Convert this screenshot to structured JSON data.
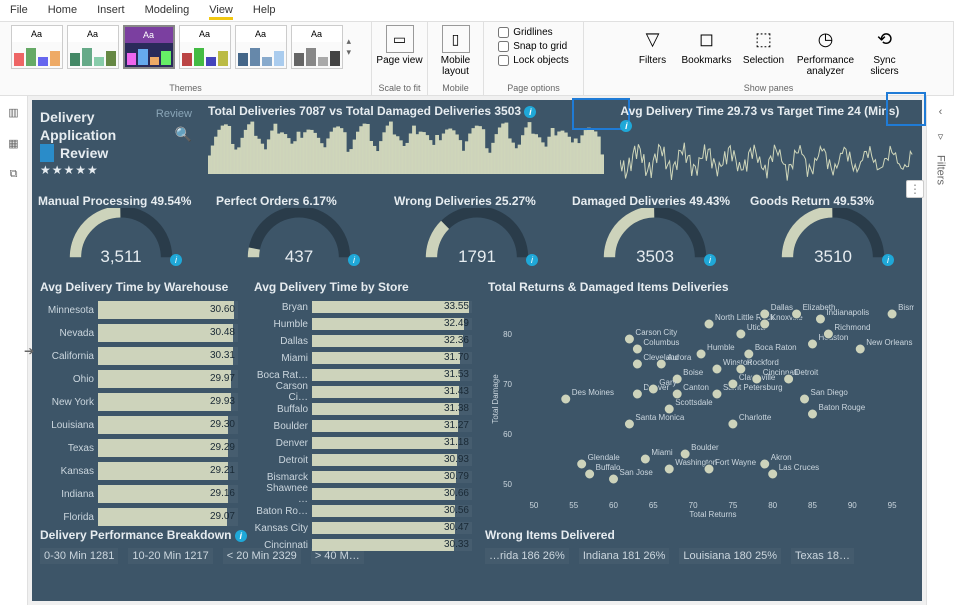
{
  "menu": {
    "file": "File",
    "home": "Home",
    "insert": "Insert",
    "modeling": "Modeling",
    "view": "View",
    "help": "Help"
  },
  "ribbon": {
    "themes_label": "Themes",
    "theme_sample": "Aa",
    "scale": {
      "page_view": "Page view",
      "label": "Scale to fit"
    },
    "mobile": {
      "layout": "Mobile layout",
      "label": "Mobile"
    },
    "page": {
      "gridlines": "Gridlines",
      "snap": "Snap to grid",
      "lock": "Lock objects",
      "label": "Page options"
    },
    "panes": {
      "filters": "Filters",
      "bookmarks": "Bookmarks",
      "selection": "Selection",
      "perf": "Performance analyzer",
      "sync": "Sync slicers",
      "label": "Show panes"
    }
  },
  "right_rail": {
    "filters": "Filters"
  },
  "title": {
    "l1": "Delivery",
    "l2": "Application",
    "l3": "Review",
    "review": "Review",
    "stars": "★★★★★"
  },
  "hdr1": {
    "text_prefix": "Total Deliveries ",
    "text_mid": " vs Total Damaged Deliveries ",
    "deliveries": "7087",
    "damaged": "3503"
  },
  "hdr2": {
    "text_prefix": "Avg Delivery Time ",
    "text_mid": " vs Target Time ",
    "text_suffix": " (Mins)",
    "avg": "29.73",
    "target": "24"
  },
  "gauges": [
    {
      "label": "Manual Processing 49.54%",
      "value": "3,511",
      "pct": 49.54
    },
    {
      "label": "Perfect Orders 6.17%",
      "value": "437",
      "pct": 6.17
    },
    {
      "label": "Wrong Deliveries 25.27%",
      "value": "1791",
      "pct": 25.27
    },
    {
      "label": "Damaged Deliveries 49.43%",
      "value": "3503",
      "pct": 49.43
    },
    {
      "label": "Goods Return 49.53%",
      "value": "3510",
      "pct": 49.53
    }
  ],
  "warehouse": {
    "title": "Avg Delivery Time by Warehouse",
    "rows": [
      {
        "label": "Minnesota",
        "value": 30.6
      },
      {
        "label": "Nevada",
        "value": 30.48
      },
      {
        "label": "California",
        "value": 30.31
      },
      {
        "label": "Ohio",
        "value": 29.97
      },
      {
        "label": "New York",
        "value": 29.93
      },
      {
        "label": "Louisiana",
        "value": 29.3
      },
      {
        "label": "Texas",
        "value": 29.29
      },
      {
        "label": "Kansas",
        "value": 29.21
      },
      {
        "label": "Indiana",
        "value": 29.16
      },
      {
        "label": "Florida",
        "value": 29.07
      }
    ]
  },
  "store": {
    "title": "Avg Delivery Time by Store",
    "rows": [
      {
        "label": "Bryan",
        "value": 33.55
      },
      {
        "label": "Humble",
        "value": 32.49
      },
      {
        "label": "Dallas",
        "value": 32.36
      },
      {
        "label": "Miami",
        "value": 31.7
      },
      {
        "label": "Boca Rat…",
        "value": 31.53
      },
      {
        "label": "Carson Ci…",
        "value": 31.43
      },
      {
        "label": "Buffalo",
        "value": 31.38
      },
      {
        "label": "Boulder",
        "value": 31.27
      },
      {
        "label": "Denver",
        "value": 31.18
      },
      {
        "label": "Detroit",
        "value": 30.93
      },
      {
        "label": "Bismarck",
        "value": 30.79
      },
      {
        "label": "Shawnee …",
        "value": 30.66
      },
      {
        "label": "Baton Ro…",
        "value": 30.56
      },
      {
        "label": "Kansas City",
        "value": 30.47
      },
      {
        "label": "Cincinnati",
        "value": 30.33
      }
    ]
  },
  "scatter": {
    "title": "Total Returns & Damaged Items Deliveries",
    "xlabel": "Total Returns",
    "ylabel": "Total Damage",
    "xticks": [
      50,
      55,
      60,
      65,
      70,
      75,
      80,
      85,
      90,
      95
    ],
    "yticks": [
      50,
      60,
      70,
      80
    ],
    "points": [
      {
        "label": "Des Moines",
        "x": 54,
        "y": 67
      },
      {
        "label": "Santa Monica",
        "x": 62,
        "y": 62
      },
      {
        "label": "Denver",
        "x": 63,
        "y": 68
      },
      {
        "label": "Glendale",
        "x": 56,
        "y": 54
      },
      {
        "label": "Buffalo",
        "x": 57,
        "y": 52
      },
      {
        "label": "San Jose",
        "x": 60,
        "y": 51
      },
      {
        "label": "Miami",
        "x": 64,
        "y": 55
      },
      {
        "label": "Washington",
        "x": 67,
        "y": 53
      },
      {
        "label": "Boulder",
        "x": 69,
        "y": 56
      },
      {
        "label": "Fort Wayne",
        "x": 72,
        "y": 53
      },
      {
        "label": "Scottsdale",
        "x": 67,
        "y": 65
      },
      {
        "label": "Canton",
        "x": 68,
        "y": 68
      },
      {
        "label": "Boise",
        "x": 68,
        "y": 71
      },
      {
        "label": "Cleveland",
        "x": 63,
        "y": 74
      },
      {
        "label": "Aurora",
        "x": 66,
        "y": 74
      },
      {
        "label": "Columbus",
        "x": 63,
        "y": 77
      },
      {
        "label": "Carson City",
        "x": 62,
        "y": 79
      },
      {
        "label": "Gary",
        "x": 65,
        "y": 69
      },
      {
        "label": "Humble",
        "x": 71,
        "y": 76
      },
      {
        "label": "Saint Petersburg",
        "x": 73,
        "y": 68
      },
      {
        "label": "Clarksville",
        "x": 75,
        "y": 70
      },
      {
        "label": "Charlotte",
        "x": 75,
        "y": 62
      },
      {
        "label": "Winston",
        "x": 73,
        "y": 73
      },
      {
        "label": "Rockford",
        "x": 76,
        "y": 73
      },
      {
        "label": "Cincinnati",
        "x": 78,
        "y": 71
      },
      {
        "label": "Boca Raton",
        "x": 77,
        "y": 76
      },
      {
        "label": "North Little Rock",
        "x": 72,
        "y": 82
      },
      {
        "label": "Utica",
        "x": 76,
        "y": 80
      },
      {
        "label": "Knoxville",
        "x": 79,
        "y": 82
      },
      {
        "label": "Dallas",
        "x": 79,
        "y": 84
      },
      {
        "label": "Akron",
        "x": 79,
        "y": 54
      },
      {
        "label": "Las Cruces",
        "x": 80,
        "y": 52
      },
      {
        "label": "Detroit",
        "x": 82,
        "y": 71
      },
      {
        "label": "San Diego",
        "x": 84,
        "y": 67
      },
      {
        "label": "Baton Rouge",
        "x": 85,
        "y": 64
      },
      {
        "label": "Houston",
        "x": 85,
        "y": 78
      },
      {
        "label": "Richmond",
        "x": 87,
        "y": 80
      },
      {
        "label": "Indianapolis",
        "x": 86,
        "y": 83
      },
      {
        "label": "Elizabeth",
        "x": 83,
        "y": 84
      },
      {
        "label": "New Orleans",
        "x": 91,
        "y": 77
      },
      {
        "label": "Bismarck",
        "x": 95,
        "y": 84
      }
    ]
  },
  "breakdown": {
    "title": "Delivery Performance Breakdown",
    "b1": "0-30 Min 1281",
    "b2": "10-20 Min 1217",
    "b3": "< 20 Min 2329",
    "b4": "> 40 M…"
  },
  "wrong": {
    "title": "Wrong Items Delivered",
    "b1": "…rida 186 26%",
    "b2": "Indiana 181 26%",
    "b3": "Louisiana 180 25%",
    "b4": "Texas 18…"
  }
}
